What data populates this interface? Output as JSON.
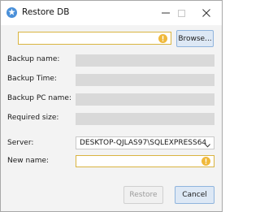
{
  "window": {
    "title": "Restore DB",
    "icon": "database-restore-icon",
    "controls": {
      "minimize_icon": "minimize-icon",
      "maximize_icon": "maximize-icon",
      "close_icon": "close-icon"
    }
  },
  "file": {
    "value": "",
    "status_icon": "warning-icon",
    "browse_label": "Browse..."
  },
  "fields": {
    "backup_name_label": "Backup name:",
    "backup_time_label": "Backup Time:",
    "backup_pc_label": "Backup PC name:",
    "required_size_label": "Required size:",
    "backup_name_value": "",
    "backup_time_value": "",
    "backup_pc_value": "",
    "required_size_value": ""
  },
  "server": {
    "label": "Server:",
    "selected": "DESKTOP-QJLAS97\\SQLEXPRESS64",
    "chevron_icon": "chevron-down-icon"
  },
  "new_name": {
    "label": "New name:",
    "value": "",
    "status_icon": "warning-icon"
  },
  "buttons": {
    "restore_label": "Restore",
    "restore_enabled": false,
    "cancel_label": "Cancel"
  },
  "colors": {
    "warning_border": "#d9b440",
    "warning_icon": "#f0b93a",
    "accent_button_bg": "#dde8f5",
    "accent_button_border": "#8fb4dd",
    "readonly_field": "#d9d9d9"
  }
}
